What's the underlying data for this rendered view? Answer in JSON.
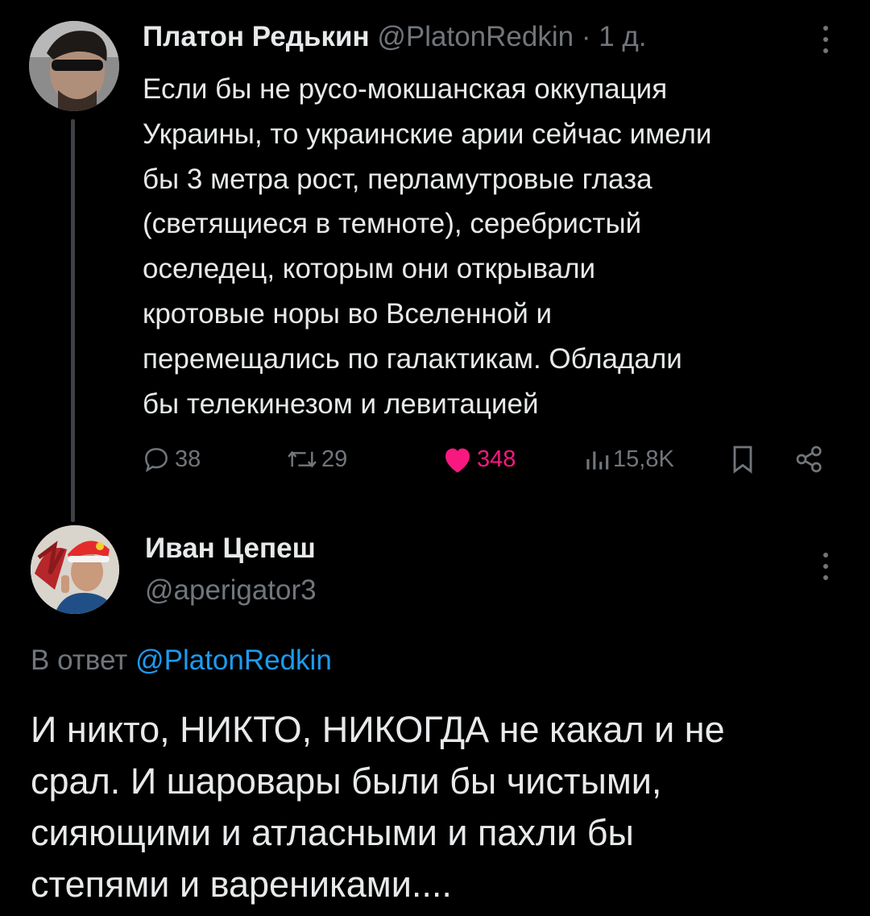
{
  "tweet": {
    "author_name": "Платон Редькин",
    "handle": "@PlatonRedkin",
    "separator": "·",
    "time": "1 д.",
    "text_lines": [
      "Если бы не русо-мокшанская оккупация",
      "Украины, то украинские арии сейчас имели",
      "бы 3 метра рост, перламутровые глаза",
      "(светящиеся в темноте), серебристый",
      "оселедец, которым они открывали",
      "кротовые норы во Вселенной и",
      "перемещались по галактикам. Обладали",
      "бы телекинезом и левитацией"
    ],
    "stats": {
      "replies": "38",
      "retweets": "29",
      "likes": "348",
      "views": "15,8K"
    },
    "colors": {
      "like": "#f91880",
      "muted": "#71767b"
    },
    "icons": [
      "reply-icon",
      "retweet-icon",
      "like-heart-icon",
      "views-icon",
      "bookmark-icon",
      "share-icon",
      "more-options-icon"
    ]
  },
  "reply": {
    "author_name": "Иван Цепеш",
    "handle": "@aperigator3",
    "reply_to_prefix": "В ответ",
    "reply_to_handle": "@PlatonRedkin",
    "text_lines": [
      "И никто, НИКТО, НИКОГДА не какал и не",
      "срал. И шаровары были бы чистыми,",
      "сияющими и атласными и пахли бы",
      "степями и варениками...."
    ],
    "colors": {
      "mention": "#1d9bf0"
    }
  }
}
